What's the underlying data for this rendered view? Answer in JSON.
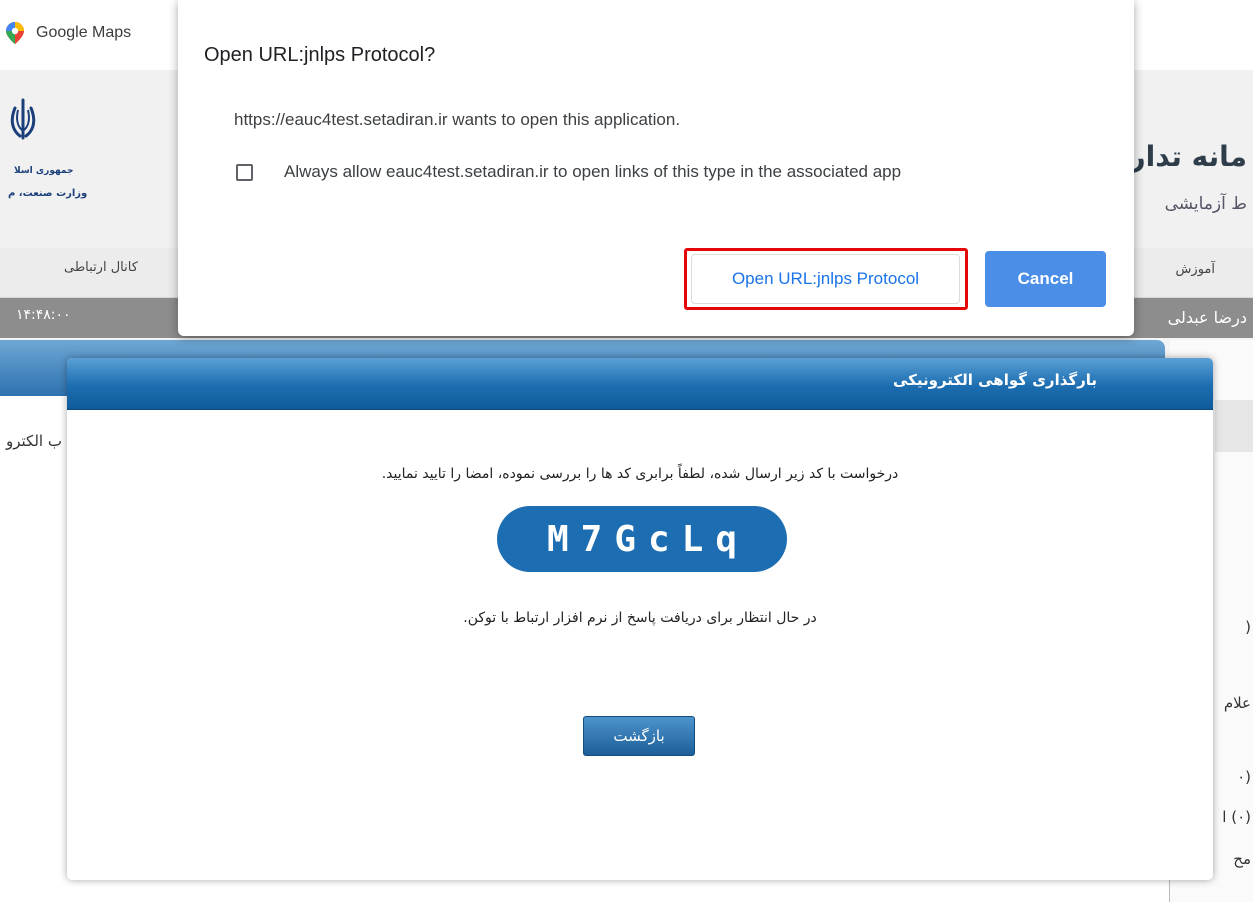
{
  "bookmarks_bar": {
    "items": [
      {
        "label": "Google Maps",
        "icon": "maps-pin-icon"
      }
    ]
  },
  "site_header": {
    "emblem_icon": "iran-emblem-icon",
    "emblem_line1": "جمهوری اسلا",
    "emblem_line2": "وزارت صنعت، م",
    "brand_title": "مانه تدار",
    "brand_subtitle": "ط آزمایشی"
  },
  "navbar": {
    "left_item": "کانال ارتباطی",
    "right_item": "آموزش"
  },
  "infobar": {
    "clock": "۱۴:۴۸:۰۰",
    "user_name": "درضا عبدلی"
  },
  "background_page": {
    "left_fragment": "ب الکترو",
    "side_fragments": [
      "(",
      "علام",
      "(۰",
      "(۰) ا",
      "مح"
    ]
  },
  "protocol_dialog": {
    "title": "Open URL:jnlps Protocol?",
    "message": "https://eauc4test.setadiran.ir wants to open this application.",
    "checkbox_label": "Always allow eauc4test.setadiran.ir to open links of this type in the associated app",
    "checkbox_checked": false,
    "open_button_label": "Open URL:jnlps Protocol",
    "cancel_button_label": "Cancel",
    "highlight_color": "#e4070a",
    "accent_color": "#1a73e8"
  },
  "certificate_modal": {
    "title": "بارگذاری گواهی الکترونیکی",
    "instruction": "درخواست با کد زیر ارسال شده، لطفاً برابری کد ها را بررسی نموده، امضا را تایید نمایید.",
    "code": "M7GcLq",
    "waiting_text": "در حال انتظار برای دریافت پاسخ از نرم افزار ارتباط با توکن.",
    "back_button_label": "بازگشت",
    "header_color": "#1c6db0",
    "code_color": "#1d6db2"
  }
}
